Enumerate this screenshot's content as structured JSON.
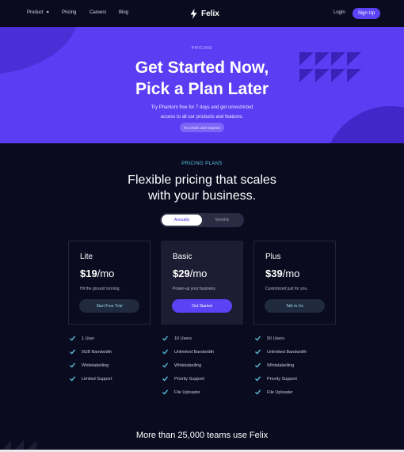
{
  "nav": {
    "product_label": "Product",
    "pricing_label": "Pricing",
    "careers_label": "Careers",
    "blog_label": "Blog",
    "brand": "Felix",
    "login_label": "Login",
    "signup_label": "Sign Up"
  },
  "hero": {
    "eyebrow": "PRICING",
    "title_line1": "Get Started Now,",
    "title_line2": "Pick a Plan Later",
    "subtitle_line1": "Try Phantom free for 7 days and get unrestricted",
    "subtitle_line2": "access to all our products and features.",
    "badge": "No credit card required"
  },
  "pricing": {
    "eyebrow": "PRICING PLANS",
    "title_line1": "Flexible pricing that scales",
    "title_line2": "with your business.",
    "toggle": {
      "annually": "Annually",
      "monthly": "Monthly",
      "selected": "Annually"
    }
  },
  "plans": [
    {
      "name": "Lite",
      "price": "$19",
      "period": "/mo",
      "description": "Hit the ground running.",
      "cta": "Start Free Trial",
      "features": [
        "1 User",
        "5GB Bandwidth",
        "Whitelabelling",
        "Limited Support"
      ]
    },
    {
      "name": "Basic",
      "price": "$29",
      "period": "/mo",
      "description": "Power-up your business.",
      "cta": "Get Started",
      "features": [
        "10 Users",
        "Unlimited Bandwidth",
        "Whitelabelling",
        "Priority Support",
        "File Uploader"
      ]
    },
    {
      "name": "Plus",
      "price": "$39",
      "period": "/mo",
      "description": "Customized just for you.",
      "cta": "Talk to Us",
      "features": [
        "50 Users",
        "Unlimited Bandwidth",
        "Whitelabelling",
        "Priority Support",
        "File Uploader"
      ]
    }
  ],
  "footer": {
    "teams_line": "More than 25,000 teams use Felix"
  },
  "colors": {
    "page_background": "#0b0b20",
    "hero_background": "#5b3df4",
    "accent": "#5b43f5",
    "eyebrow_teal": "#5cc8de",
    "check": "#5cc8de"
  },
  "icons": {
    "logo": "lightning-bolt-icon",
    "check": "check-icon",
    "caret": "chevron-down-icon"
  }
}
